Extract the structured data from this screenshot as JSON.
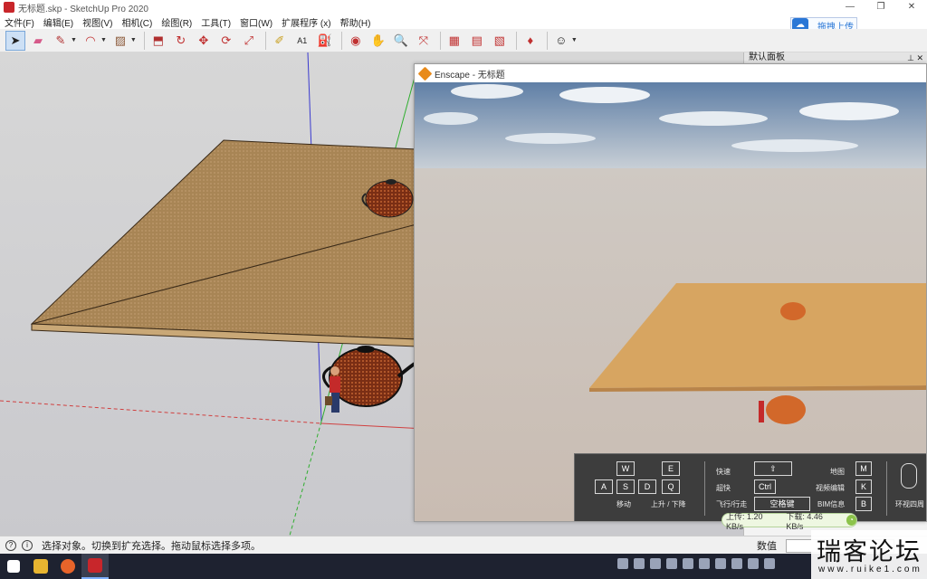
{
  "window": {
    "title": "无标题.skp - SketchUp Pro 2020",
    "controls": [
      "—",
      "❐",
      "✕"
    ]
  },
  "menu": [
    "文件(F)",
    "编辑(E)",
    "视图(V)",
    "相机(C)",
    "绘图(R)",
    "工具(T)",
    "窗口(W)",
    "扩展程序 (x)",
    "帮助(H)"
  ],
  "cloud_button": {
    "label": "拖拽上传"
  },
  "tray": {
    "title": "默认面板",
    "pins": "⊥ ✕"
  },
  "enscape": {
    "title": "Enscape - 无标题",
    "keys": {
      "w": "W",
      "e": "E",
      "a": "A",
      "s": "S",
      "d": "D",
      "q": "Q",
      "shift": "⇧",
      "ctrl": "Ctrl",
      "space": "空格键",
      "m": "M",
      "k": "K",
      "b": "B"
    },
    "labels": {
      "move": "移动",
      "updown": "上升 / 下降",
      "fast": "快速",
      "ultra_fast": "超快",
      "fly_walk": "飞行/行走",
      "map": "地图",
      "video_edit": "视频编辑",
      "bim_info": "BIM信息",
      "look_around": "环视四周"
    }
  },
  "netspeed": {
    "up": "上传: 1.20 KB/s",
    "down": "下载: 4.46 KB/s"
  },
  "status": {
    "message": "选择对象。切换到扩充选择。拖动鼠标选择多项。",
    "measurement_label": "数值"
  },
  "watermark": {
    "title": "瑞客论坛",
    "url": "www.ruike1.com"
  },
  "colors": {
    "axis_blue": "#3a3acf",
    "axis_green": "#2fae2f",
    "axis_red": "#d04040",
    "plane_top": "#b08d5b",
    "ens_plane": "#d7a561",
    "teapot": "#8a3b1a"
  }
}
